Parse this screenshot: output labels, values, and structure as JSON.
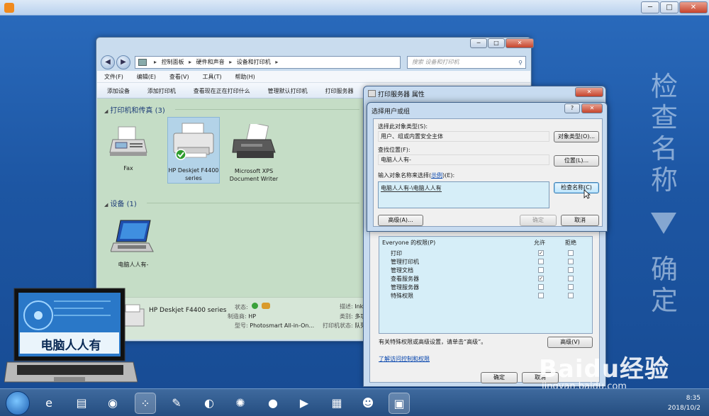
{
  "player": {
    "controls": {
      "min": "─",
      "max": "□",
      "close": "✕"
    }
  },
  "sidebar_text": {
    "top": [
      "检",
      "查",
      "名",
      "称"
    ],
    "bottom": [
      "确",
      "定"
    ]
  },
  "explorer": {
    "caption": {
      "min": "─",
      "max": "□",
      "close": "✕"
    },
    "nav": {
      "back": "◀",
      "forward": "▶"
    },
    "breadcrumb": [
      "控制面板",
      "硬件和声音",
      "设备和打印机"
    ],
    "search_placeholder": "搜索 设备和打印机",
    "menu": [
      "文件(F)",
      "编辑(E)",
      "查看(V)",
      "工具(T)",
      "帮助(H)"
    ],
    "commands": [
      "添加设备",
      "添加打印机",
      "查看现在正在打印什么",
      "管理默认打印机",
      "打印服务器"
    ],
    "groups": {
      "printers": "打印机和传真 (3)",
      "devices": "设备 (1)"
    },
    "printers": [
      {
        "label": "Fax"
      },
      {
        "label": "HP Deskjet F4400 series",
        "default": true
      },
      {
        "label": "Microsoft XPS Document Writer"
      }
    ],
    "devices": [
      {
        "label": "电脑人人有-"
      }
    ],
    "details": {
      "name": "HP Deskjet F4400 series",
      "status_label": "状态:",
      "manufacturer_label": "制造商:",
      "manufacturer": "HP",
      "model_label": "型号:",
      "model": "Photosmart All-in-On...",
      "desc_label": "描述:",
      "desc": "Ink",
      "category_label": "类别:",
      "category": "多功",
      "printer_status_label": "打印机状态:",
      "printer_status": "队列"
    }
  },
  "props_dialog": {
    "title": "打印服务器 属性",
    "close": "✕",
    "perm_header": "Everyone 的权限(P)",
    "allow": "允许",
    "deny": "拒绝",
    "permissions": [
      {
        "name": "打印",
        "allow": true
      },
      {
        "name": "管理打印机",
        "allow": false
      },
      {
        "name": "管理文档",
        "allow": false
      },
      {
        "name": "查看服务器",
        "allow": true
      },
      {
        "name": "管理服务器",
        "allow": false
      },
      {
        "name": "特殊权限",
        "allow": false
      }
    ],
    "advanced_hint": "有关特殊权限或高级设置，请单击“高级”。",
    "advanced_button": "高级(V)",
    "link": "了解访问控制和权限",
    "ok": "确定",
    "cancel": "取消"
  },
  "select_dialog": {
    "title": "选择用户或组",
    "help": "?",
    "close": "✕",
    "object_type_label": "选择此对象类型(S):",
    "object_type_value": "用户、组或内置安全主体",
    "object_type_button": "对象类型(O)...",
    "location_label": "查找位置(F):",
    "location_value": "电脑人人有-",
    "location_button": "位置(L)...",
    "names_label_prefix": "输入对象名称来选择(",
    "names_label_link": "示例",
    "names_label_suffix": ")(E):",
    "names_value": "电脑人人有-\\电脑人人有",
    "check_names_button": "检查名称(C)",
    "advanced_button": "高级(A)...",
    "ok": "确定",
    "cancel": "取消"
  },
  "taskbar": {
    "time": "8:35",
    "date": "2018/10/2"
  },
  "overlay": {
    "laptop_caption": "电脑人人有",
    "baidu_brand": "Baidu经验",
    "baidu_site": "jingyan.baidu.com"
  }
}
